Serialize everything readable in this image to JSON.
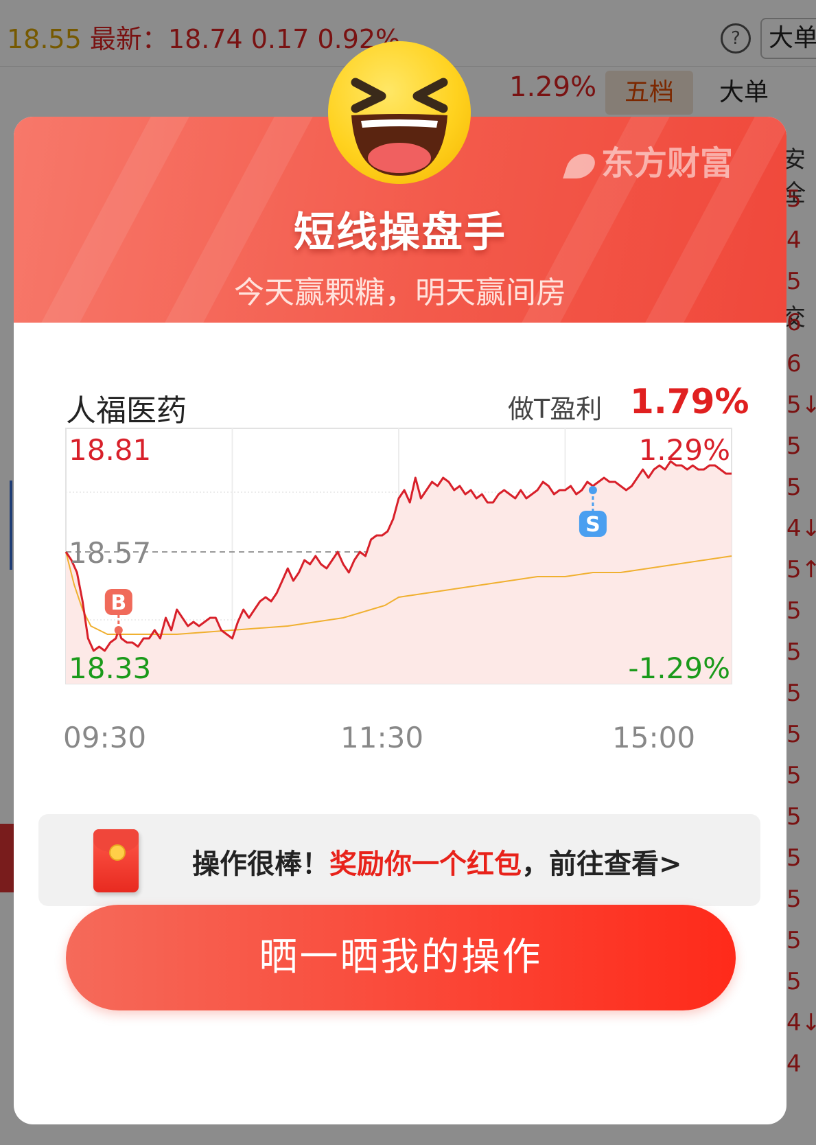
{
  "background_app": {
    "quote_prefix": "18.55",
    "quote_text": "最新：18.74  0.17  0.92%",
    "help_glyph": "?",
    "top_right_tab": "大单",
    "chart_pct": "1.29%",
    "tabs": [
      "五档",
      "大单"
    ],
    "side_labels": [
      "安全",
      "交"
    ],
    "right_numbers": [
      "5",
      "4",
      "5",
      "6",
      "6",
      "5↓",
      "5",
      "5",
      "4↓",
      "5↑",
      "5",
      "5",
      "5",
      "5",
      "5",
      "5",
      "5",
      "5",
      "5",
      "5",
      "4↓",
      "4"
    ]
  },
  "modal": {
    "brand": "东方财富",
    "title": "短线操盘手",
    "subtitle": "今天赢颗糖，明天赢间房",
    "stock_name": "人福医药",
    "profit_label": "做T盈利",
    "profit_value": "1.79%",
    "reward": {
      "prefix": "操作很棒！",
      "highlight": "奖励你一个红包",
      "suffix": "，前往查看>"
    },
    "share_button": "晒一晒我的操作",
    "colors": {
      "accent": "#f0483b",
      "up": "#e02020",
      "down": "#1a9a1a",
      "avg": "#f0b030",
      "sell_marker": "#4a9ff0"
    }
  },
  "chart_data": {
    "type": "line",
    "x_labels": [
      "09:30",
      "11:30",
      "15:00"
    ],
    "y_labels": {
      "high": "18.81",
      "prev_close": "18.57",
      "low": "18.33"
    },
    "pct_labels": {
      "high": "1.29%",
      "low": "-1.29%"
    },
    "ylim": [
      18.33,
      18.81
    ],
    "prev_close": 18.57,
    "markers": [
      {
        "label": "B",
        "minute": 19,
        "price": 18.38,
        "color": "#f06a5a"
      },
      {
        "label": "S",
        "minute": 190,
        "price": 18.72,
        "color": "#4a9ff0"
      }
    ],
    "series": [
      {
        "role": "price",
        "x": [
          0,
          2,
          4,
          6,
          8,
          10,
          12,
          14,
          16,
          18,
          19,
          20,
          22,
          24,
          26,
          28,
          30,
          32,
          34,
          36,
          38,
          40,
          42,
          44,
          46,
          48,
          50,
          52,
          54,
          56,
          58,
          60,
          62,
          64,
          66,
          68,
          70,
          72,
          74,
          76,
          78,
          80,
          82,
          84,
          86,
          88,
          90,
          92,
          94,
          96,
          98,
          100,
          102,
          104,
          106,
          108,
          110,
          112,
          114,
          116,
          118,
          120,
          122,
          124,
          126,
          128,
          130,
          132,
          134,
          136,
          138,
          140,
          142,
          144,
          146,
          148,
          150,
          152,
          154,
          156,
          158,
          160,
          162,
          164,
          166,
          168,
          170,
          172,
          174,
          176,
          178,
          180,
          182,
          184,
          186,
          188,
          190,
          192,
          194,
          196,
          198,
          200,
          202,
          204,
          206,
          208,
          210,
          212,
          214,
          216,
          218,
          220,
          222,
          224,
          226,
          228,
          230,
          232,
          234,
          236,
          238,
          240
        ],
        "y": [
          18.57,
          18.55,
          18.52,
          18.45,
          18.36,
          18.33,
          18.34,
          18.33,
          18.35,
          18.36,
          18.38,
          18.36,
          18.35,
          18.35,
          18.34,
          18.36,
          18.36,
          18.38,
          18.36,
          18.41,
          18.38,
          18.43,
          18.41,
          18.39,
          18.4,
          18.39,
          18.4,
          18.41,
          18.41,
          18.38,
          18.37,
          18.36,
          18.4,
          18.43,
          18.41,
          18.43,
          18.45,
          18.46,
          18.45,
          18.47,
          18.5,
          18.53,
          18.5,
          18.52,
          18.55,
          18.54,
          18.56,
          18.54,
          18.53,
          18.55,
          18.57,
          18.54,
          18.52,
          18.55,
          18.57,
          18.56,
          18.6,
          18.61,
          18.61,
          18.62,
          18.65,
          18.7,
          18.72,
          18.69,
          18.75,
          18.7,
          18.72,
          18.74,
          18.73,
          18.75,
          18.74,
          18.72,
          18.73,
          18.71,
          18.72,
          18.7,
          18.71,
          18.69,
          18.69,
          18.71,
          18.72,
          18.71,
          18.7,
          18.72,
          18.7,
          18.71,
          18.72,
          18.74,
          18.73,
          18.71,
          18.72,
          18.72,
          18.73,
          18.71,
          18.72,
          18.74,
          18.73,
          18.74,
          18.75,
          18.74,
          18.74,
          18.73,
          18.72,
          18.73,
          18.75,
          18.77,
          18.75,
          18.77,
          18.78,
          18.77,
          18.79,
          18.78,
          18.78,
          18.77,
          18.78,
          18.77,
          18.77,
          18.78,
          18.78,
          18.77,
          18.76,
          18.76
        ]
      },
      {
        "role": "average",
        "x": [
          0,
          3,
          6,
          9,
          12,
          15,
          20,
          30,
          40,
          60,
          80,
          100,
          110,
          115,
          120,
          130,
          140,
          150,
          160,
          170,
          180,
          190,
          200,
          210,
          220,
          230,
          240
        ],
        "y": [
          18.57,
          18.49,
          18.43,
          18.39,
          18.38,
          18.37,
          18.37,
          18.37,
          18.37,
          18.38,
          18.39,
          18.41,
          18.43,
          18.44,
          18.46,
          18.47,
          18.48,
          18.49,
          18.5,
          18.51,
          18.51,
          18.52,
          18.52,
          18.53,
          18.54,
          18.55,
          18.56
        ]
      }
    ]
  }
}
